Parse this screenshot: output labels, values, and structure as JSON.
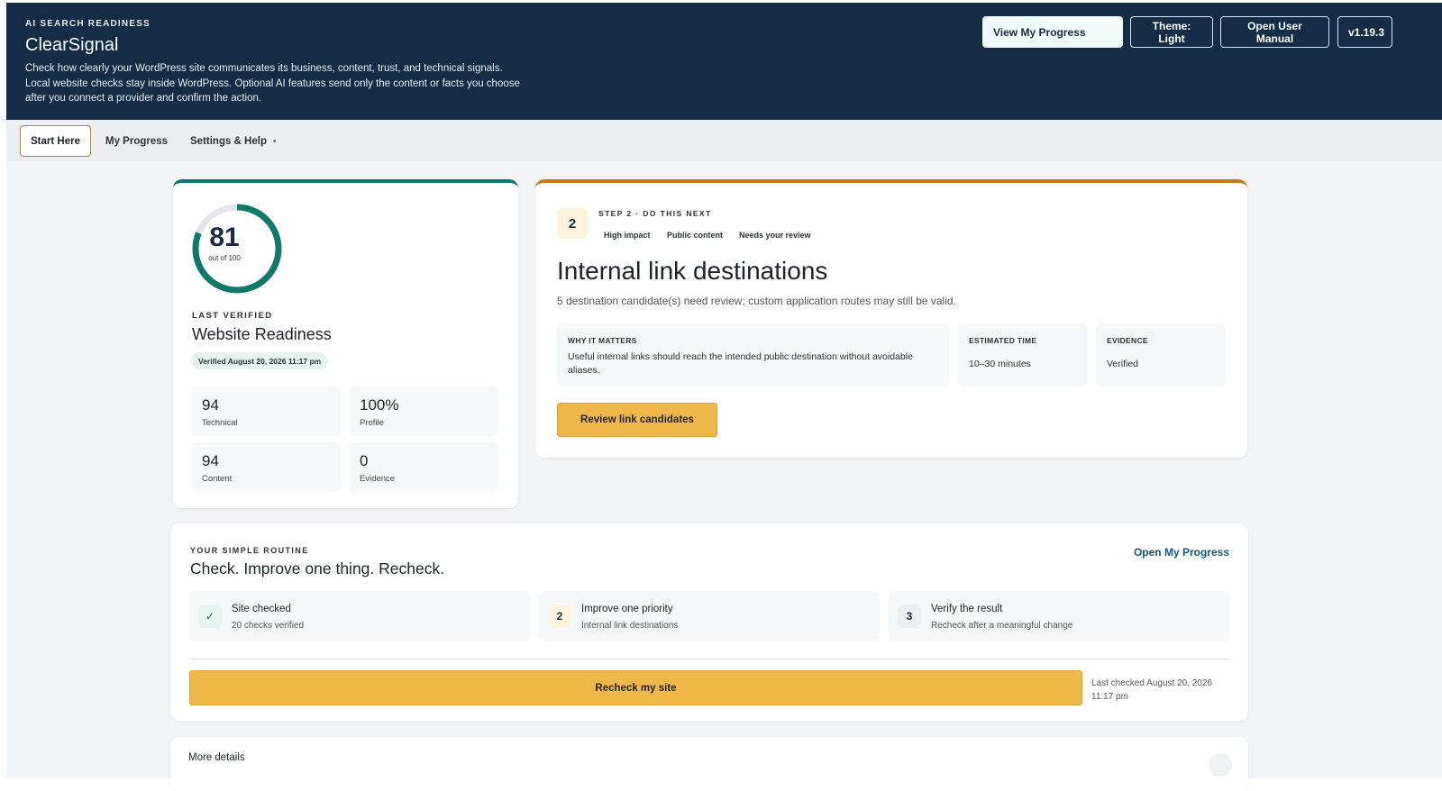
{
  "header": {
    "eyebrow": "AI SEARCH READINESS",
    "title": "ClearSignal",
    "description": "Check how clearly your WordPress site communicates its business, content, trust, and technical signals. Local website checks stay inside WordPress. Optional AI features send only the content or facts you choose after you connect a provider and confirm the action.",
    "buttons": {
      "view_progress": "View My Progress",
      "theme": "Theme: Light",
      "manual": "Open User Manual",
      "version": "v1.19.3"
    }
  },
  "tabs": {
    "start": "Start Here",
    "progress": "My Progress",
    "settings": "Settings & Help",
    "settings_caret": "▾"
  },
  "score": {
    "value": "81",
    "max_label": "out of 100",
    "fraction": 0.81,
    "last_verified_label": "LAST VERIFIED",
    "title": "Website Readiness",
    "verified_badge": "Verified August 20, 2026 11:17 pm",
    "metrics": [
      {
        "value": "94",
        "label": "Technical"
      },
      {
        "value": "100%",
        "label": "Profile"
      },
      {
        "value": "94",
        "label": "Content"
      },
      {
        "value": "0",
        "label": "Evidence"
      }
    ]
  },
  "next_step": {
    "number": "2",
    "label": "STEP 2 · DO THIS NEXT",
    "chips": [
      "High impact",
      "Public content",
      "Needs your review"
    ],
    "title": "Internal link destinations",
    "description": "5 destination candidate(s) need review; custom application routes may still be valid.",
    "why_label": "WHY IT MATTERS",
    "why_text": "Useful internal links should reach the intended public destination without avoidable aliases.",
    "time_label": "ESTIMATED TIME",
    "time_value": "10–30 minutes",
    "evidence_label": "EVIDENCE",
    "evidence_value": "Verified",
    "button": "Review link candidates"
  },
  "routine": {
    "eyebrow": "YOUR SIMPLE ROUTINE",
    "title": "Check. Improve one thing. Recheck.",
    "link": "Open My Progress",
    "steps": [
      {
        "badge": "✓",
        "title": "Site checked",
        "subtitle": "20 checks verified"
      },
      {
        "badge": "2",
        "title": "Improve one priority",
        "subtitle": "Internal link destinations"
      },
      {
        "badge": "3",
        "title": "Verify the result",
        "subtitle": "Recheck after a meaningful change"
      }
    ],
    "recheck_button": "Recheck my site",
    "last_checked": "Last checked August 20, 2026 11:17 pm"
  },
  "more": {
    "title": "More details"
  },
  "colors": {
    "header_bg": "#142c45",
    "accent_teal": "#0f7a6c",
    "accent_orange": "#c47a14",
    "cta_yellow": "#f0b849"
  }
}
